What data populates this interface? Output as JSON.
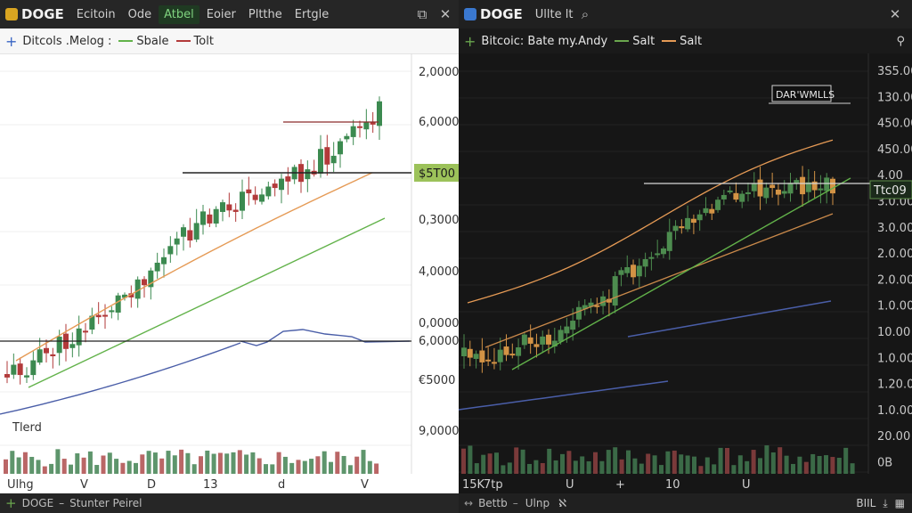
{
  "left": {
    "symbol": "DOGE",
    "tabs": [
      "Ecitoin",
      "Ode",
      "Atbel",
      "Eoier",
      "Pltthe",
      "Ertgle"
    ],
    "active_tab": 2,
    "legend": {
      "title": "Ditcols .Melog :",
      "items": [
        "Sbale",
        "Tolt"
      ]
    },
    "price_tag": "$5T00",
    "y_labels": [
      "2,0000",
      "6,0000",
      "0,3000",
      "4,0000",
      "0,0000",
      "6,0000",
      "€5000",
      "9,0000"
    ],
    "x_labels": [
      "Ulhg",
      "V",
      "D",
      "13",
      "d",
      "V"
    ],
    "indicator_label": "Tlerd",
    "bottom": {
      "symbol": "DOGE",
      "sep": "–",
      "text": "Stunter Peirel"
    }
  },
  "right": {
    "symbol": "DOGE",
    "tab": "Ullte lt",
    "legend": {
      "title": "Bitcoic: Bate my.Andy",
      "items": [
        "Salt",
        "Salt"
      ]
    },
    "annotation": "DAR'WMLLS",
    "price_tag": "Ttc09",
    "y_labels": [
      "3S5.00",
      "130.00",
      "450.00",
      "450.00",
      "4.00",
      "3.0.00",
      "3.0.00",
      "2.0.00",
      "2.0.00",
      "1.0.00",
      "10.00",
      "1.0.00",
      "1.20.00",
      "1.0.00",
      "20.00",
      "0B"
    ],
    "x_labels": [
      "15K",
      "7tp",
      "U",
      "+",
      "10",
      "U"
    ],
    "bottom": {
      "items": [
        "Bettb",
        "Ulnp"
      ]
    },
    "bottom_right": "BIIL"
  },
  "colors": {
    "bull": "#3c8a50",
    "bear": "#b23a3a",
    "dark_bull": "#4d8c4f",
    "dark_bear": "#d39345",
    "ma_green": "#62b24a",
    "ma_orange": "#e59a55",
    "ma_blue": "#4a5ea8",
    "accent_green": "#6aa64e"
  },
  "chart_data": [
    {
      "type": "line",
      "title": "Ditcols .Melog :",
      "series": [
        {
          "name": "Sbale",
          "values": [
            438,
            421,
            395,
            362,
            322,
            293,
            266,
            240,
            214,
            196
          ]
        },
        {
          "name": "Tolt",
          "values": [
            403,
            400,
            378,
            345,
            302,
            262,
            240,
            213,
            196,
            178
          ]
        }
      ],
      "ylabels_right": [
        "2,0000",
        "6,0000",
        "0,3000",
        "4,0000",
        "0,0000",
        "6,0000",
        "€5000",
        "9,0000"
      ]
    },
    {
      "type": "line",
      "title": "Bitcoic: Bate my.Andy",
      "series": [
        {
          "name": "Salt",
          "values": [
            400,
            380,
            345,
            312,
            288,
            254,
            224,
            200,
            196,
            205
          ]
        },
        {
          "name": "Salt",
          "values": [
            366,
            375,
            362,
            348,
            330,
            302,
            284,
            276,
            252,
            236
          ]
        }
      ]
    }
  ]
}
